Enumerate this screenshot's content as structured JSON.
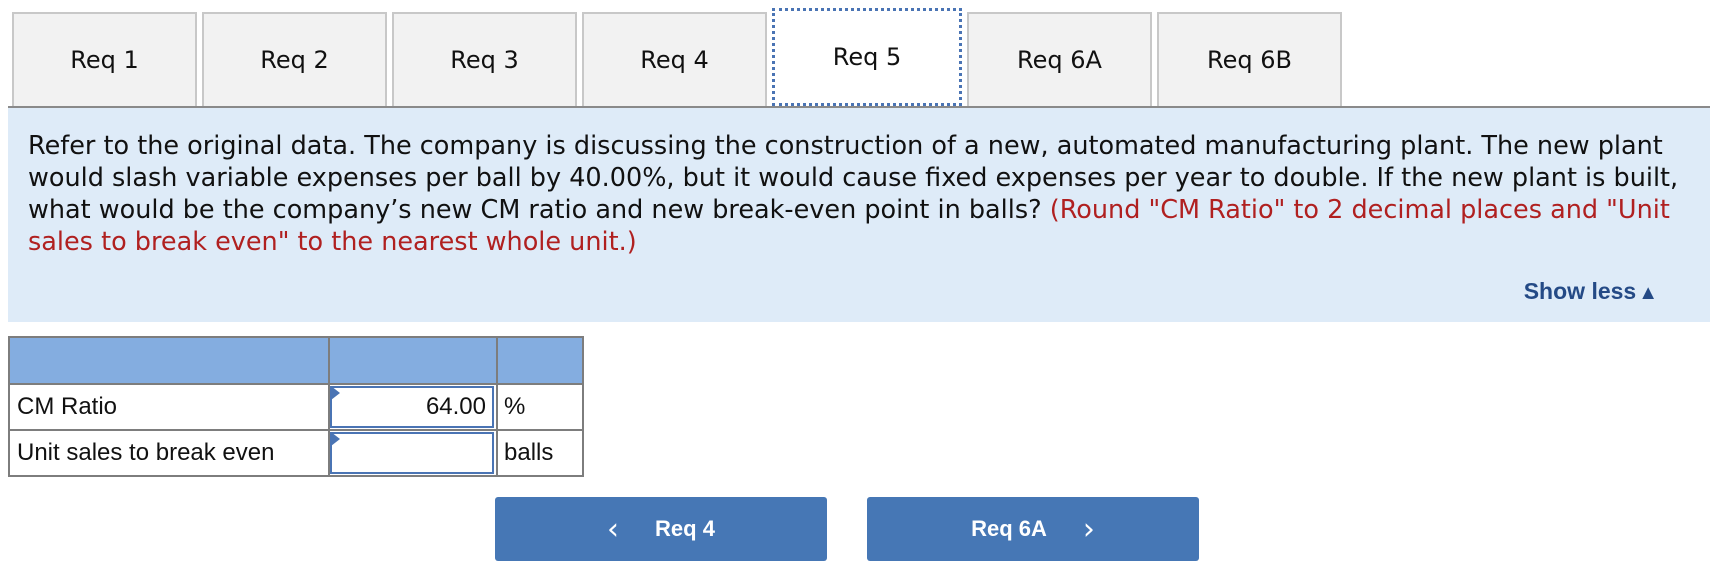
{
  "tabs": [
    {
      "label": "Req 1",
      "active": false
    },
    {
      "label": "Req 2",
      "active": false
    },
    {
      "label": "Req 3",
      "active": false
    },
    {
      "label": "Req 4",
      "active": false
    },
    {
      "label": "Req 5",
      "active": true
    },
    {
      "label": "Req 6A",
      "active": false
    },
    {
      "label": "Req 6B",
      "active": false
    }
  ],
  "question": {
    "text": "Refer to the original data. The company is discussing the construction of a new, automated manufacturing plant. The new plant would slash variable expenses per ball by 40.00%, but it would cause fixed expenses per year to double. If the new plant is built, what would be the company’s new CM ratio and new break-even point in balls? ",
    "hint": "(Round \"CM Ratio\" to 2 decimal places and \"Unit sales to break even\" to the nearest whole unit.)",
    "show_less_label": "Show less",
    "show_less_icon": "▲"
  },
  "answer_table": {
    "rows": [
      {
        "label": "CM Ratio",
        "value": "64.00",
        "unit": "%"
      },
      {
        "label": "Unit sales to break even",
        "value": "",
        "unit": "balls"
      }
    ]
  },
  "nav": {
    "prev_label": "Req 4",
    "prev_icon": "‹",
    "next_label": "Req 6A",
    "next_icon": "›"
  }
}
